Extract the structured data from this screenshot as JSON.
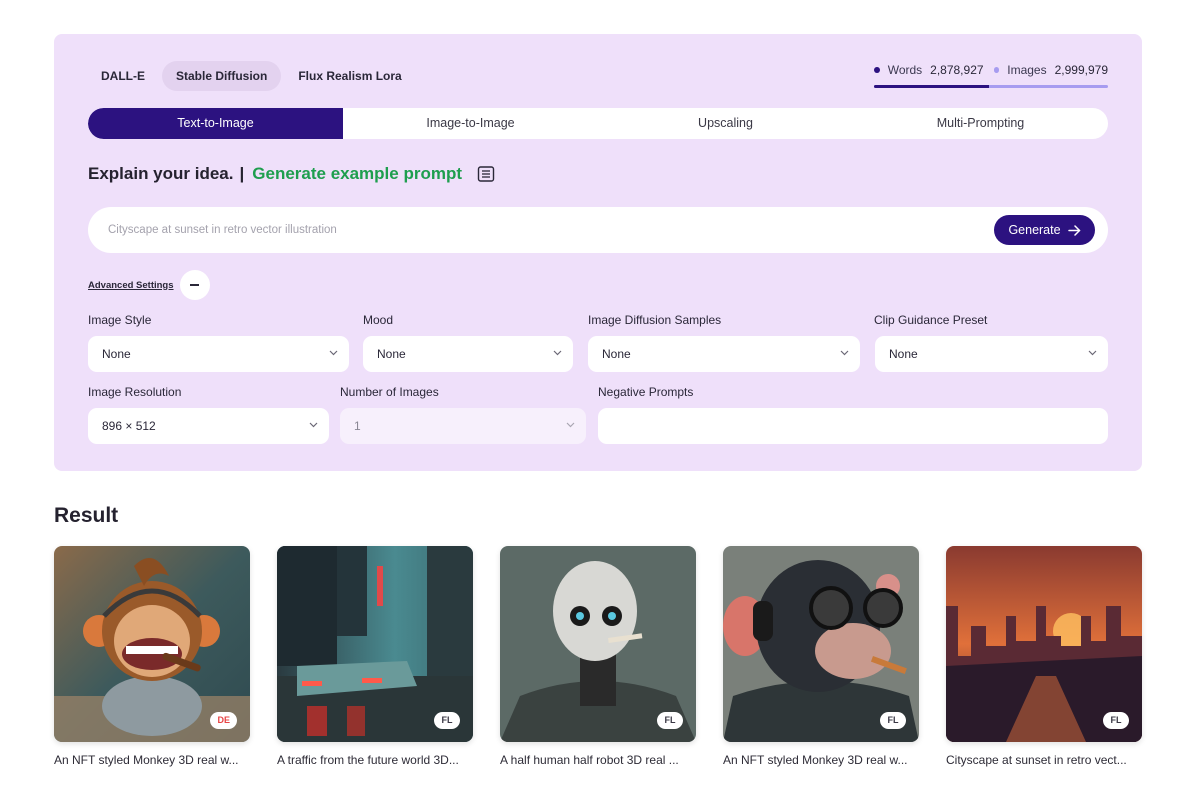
{
  "model_tabs": [
    {
      "label": "DALL-E",
      "active": false
    },
    {
      "label": "Stable Diffusion",
      "active": true
    },
    {
      "label": "Flux Realism Lora",
      "active": false
    }
  ],
  "stats": {
    "words_label": "Words",
    "words_value": "2,878,927",
    "images_label": "Images",
    "images_value": "2,999,979",
    "words_share_percent": 49,
    "colors": {
      "words": "#2c1280",
      "images": "#a79cf0"
    }
  },
  "mode_tabs": [
    {
      "label": "Text-to-Image",
      "active": true
    },
    {
      "label": "Image-to-Image",
      "active": false
    },
    {
      "label": "Upscaling",
      "active": false
    },
    {
      "label": "Multi-Prompting",
      "active": false
    }
  ],
  "headline": {
    "main": "Explain your idea.",
    "separator": "|",
    "link": "Generate example prompt",
    "icon": "document-list-icon"
  },
  "prompt": {
    "value": "",
    "placeholder": "Cityscape at sunset in retro vector illustration",
    "generate_label": "Generate",
    "generate_icon": "arrow-right-icon"
  },
  "advanced": {
    "label": "Advanced Settings",
    "toggle_icon": "minus-icon",
    "expanded": true
  },
  "settings": {
    "image_style": {
      "label": "Image Style",
      "value": "None"
    },
    "mood": {
      "label": "Mood",
      "value": "None"
    },
    "diffusion_samples": {
      "label": "Image Diffusion Samples",
      "value": "None"
    },
    "clip_guidance": {
      "label": "Clip Guidance Preset",
      "value": "None"
    },
    "resolution": {
      "label": "Image Resolution",
      "value": "896 × 512"
    },
    "num_images": {
      "label": "Number of Images",
      "value": "1",
      "disabled": true
    },
    "negative_prompts": {
      "label": "Negative Prompts",
      "value": "",
      "placeholder": ""
    }
  },
  "results": {
    "title": "Result",
    "items": [
      {
        "caption": "An NFT styled Monkey 3D real w...",
        "badge": "DE",
        "subject": "cartoon monkey with headphones and cigar"
      },
      {
        "caption": "A traffic from the future world 3D...",
        "badge": "FL",
        "subject": "rainy neon city street with car"
      },
      {
        "caption": "A half human half robot 3D real ...",
        "badge": "FL",
        "subject": "robot skull smoking"
      },
      {
        "caption": "An NFT styled Monkey 3D real w...",
        "badge": "FL",
        "subject": "chimpanzee with glasses and headphones"
      },
      {
        "caption": "Cityscape at sunset in retro vect...",
        "badge": "FL",
        "subject": "retro city skyline at sunset"
      }
    ]
  },
  "colors": {
    "panel_bg": "#efe0fa",
    "primary": "#2c1280",
    "link_green": "#1e9e4e",
    "badge_de": "#e84444"
  }
}
